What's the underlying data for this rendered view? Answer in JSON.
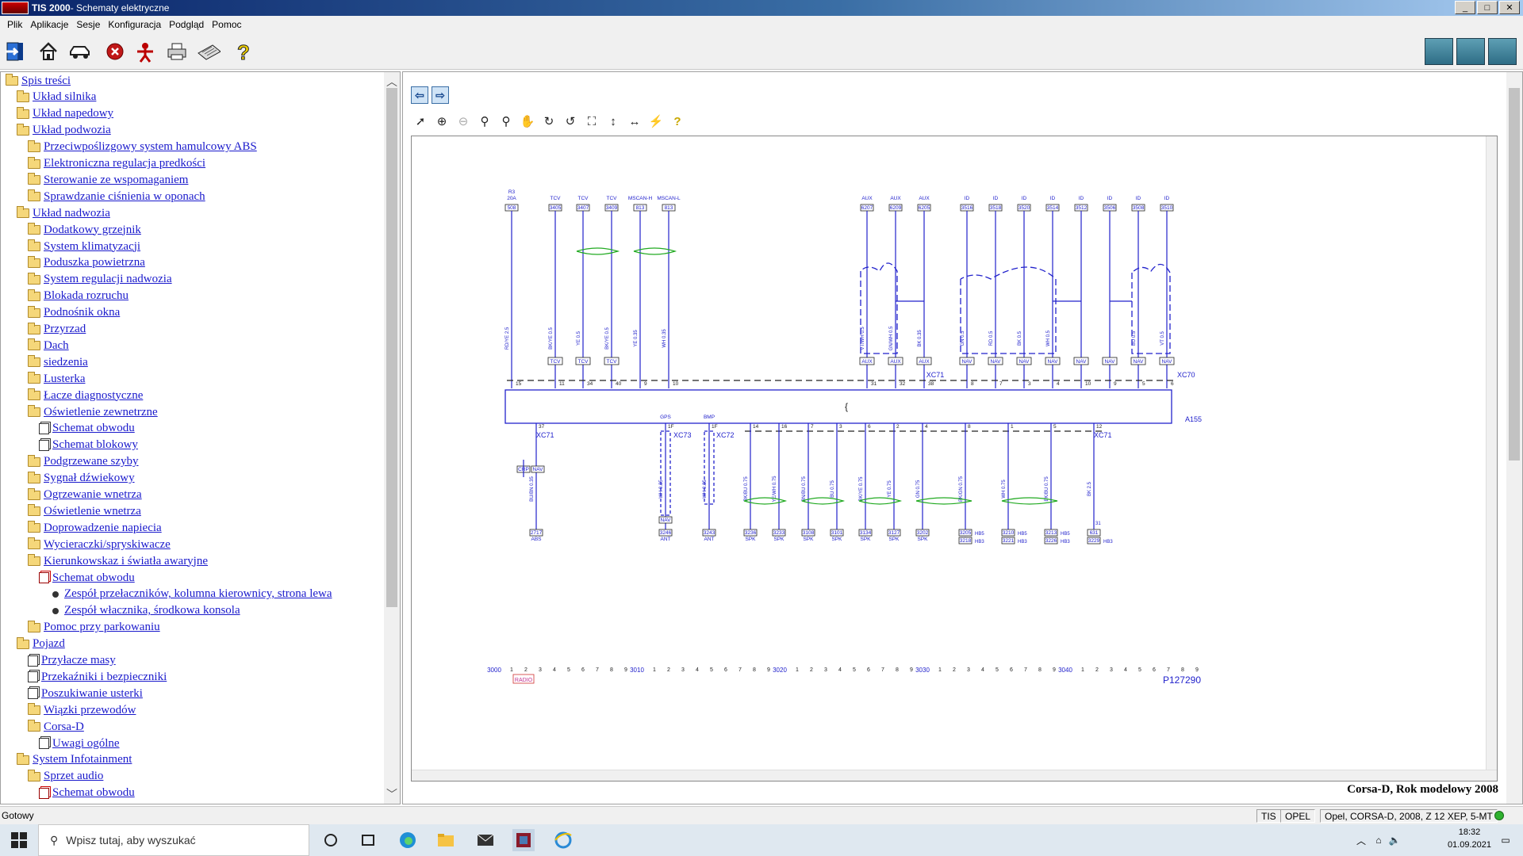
{
  "window": {
    "app": "TIS 2000",
    "title": " - Schematy elektryczne",
    "btn_min": "_",
    "btn_max": "□",
    "btn_close": "✕"
  },
  "menu": [
    "Plik",
    "Aplikacje",
    "Sesje",
    "Konfiguracja",
    "Podgląd",
    "Pomoc"
  ],
  "toolbar_icons": [
    "exit-icon",
    "home-icon",
    "car-icon",
    "stop-icon",
    "person-icon",
    "printer-icon",
    "keyboard-icon",
    "help-icon"
  ],
  "toolbar_right_icons": [
    "vehicle-check-icon",
    "vehicle-diagnostic-icon",
    "vehicle-service-icon"
  ],
  "tree": [
    {
      "label": "Spis treści",
      "level": 0,
      "icon": "folder"
    },
    {
      "label": "Układ silnika",
      "level": 1,
      "icon": "folder"
    },
    {
      "label": "Układ napedowy",
      "level": 1,
      "icon": "folder"
    },
    {
      "label": "Układ podwozia",
      "level": 1,
      "icon": "folder"
    },
    {
      "label": "Przeciwpoślizgowy system hamulcowy ABS",
      "level": 2,
      "icon": "folder"
    },
    {
      "label": "Elektroniczna regulacja predkości",
      "level": 2,
      "icon": "folder"
    },
    {
      "label": "Sterowanie ze wspomaganiem",
      "level": 2,
      "icon": "folder"
    },
    {
      "label": "Sprawdzanie ciśnienia w oponach",
      "level": 2,
      "icon": "folder"
    },
    {
      "label": "Układ nadwozia",
      "level": 1,
      "icon": "folder"
    },
    {
      "label": "Dodatkowy grzejnik",
      "level": 2,
      "icon": "folder"
    },
    {
      "label": "System klimatyzacji",
      "level": 2,
      "icon": "folder"
    },
    {
      "label": "Poduszka powietrzna",
      "level": 2,
      "icon": "folder"
    },
    {
      "label": "System regulacji nadwozia",
      "level": 2,
      "icon": "folder"
    },
    {
      "label": "Blokada rozruchu",
      "level": 2,
      "icon": "folder"
    },
    {
      "label": "Podnośnik okna",
      "level": 2,
      "icon": "folder"
    },
    {
      "label": "Przyrzad",
      "level": 2,
      "icon": "folder"
    },
    {
      "label": "Dach",
      "level": 2,
      "icon": "folder"
    },
    {
      "label": "siedzenia",
      "level": 2,
      "icon": "folder"
    },
    {
      "label": "Lusterka",
      "level": 2,
      "icon": "folder"
    },
    {
      "label": "Łacze diagnostyczne",
      "level": 2,
      "icon": "folder"
    },
    {
      "label": "Oświetlenie zewnetrzne",
      "level": 2,
      "icon": "folder"
    },
    {
      "label": "Schemat obwodu",
      "level": 3,
      "icon": "doc"
    },
    {
      "label": "Schemat blokowy",
      "level": 3,
      "icon": "doc"
    },
    {
      "label": "Podgrzewane szyby",
      "level": 2,
      "icon": "folder"
    },
    {
      "label": "Sygnał dźwiekowy",
      "level": 2,
      "icon": "folder"
    },
    {
      "label": "Ogrzewanie wnetrza",
      "level": 2,
      "icon": "folder"
    },
    {
      "label": "Oświetlenie wnetrza",
      "level": 2,
      "icon": "folder"
    },
    {
      "label": "Doprowadzenie napiecia",
      "level": 2,
      "icon": "folder"
    },
    {
      "label": "Wycieraczki/spryskiwacze",
      "level": 2,
      "icon": "folder"
    },
    {
      "label": "Kierunkowskaz i światła awaryjne",
      "level": 2,
      "icon": "folder"
    },
    {
      "label": "Schemat obwodu",
      "level": 3,
      "icon": "docred"
    },
    {
      "label": "Zespół przełaczników, kolumna kierownicy, strona lewa",
      "level": 4,
      "icon": "bullet"
    },
    {
      "label": "Zespół włacznika, środkowa konsola",
      "level": 4,
      "icon": "bullet"
    },
    {
      "label": "Pomoc przy parkowaniu",
      "level": 2,
      "icon": "folder"
    },
    {
      "label": "Pojazd",
      "level": 1,
      "icon": "folder"
    },
    {
      "label": "Przyłacze masy",
      "level": 2,
      "icon": "doc"
    },
    {
      "label": "Przekaźniki i bezpieczniki",
      "level": 2,
      "icon": "doc"
    },
    {
      "label": "Poszukiwanie usterki",
      "level": 2,
      "icon": "doc"
    },
    {
      "label": "Wiązki przewodów",
      "level": 2,
      "icon": "folder"
    },
    {
      "label": "Corsa-D",
      "level": 2,
      "icon": "folder"
    },
    {
      "label": "Uwagi ogólne",
      "level": 3,
      "icon": "doc"
    },
    {
      "label": "System Infotainment",
      "level": 1,
      "icon": "folder"
    },
    {
      "label": "Sprzet audio",
      "level": 2,
      "icon": "folder"
    },
    {
      "label": "Schemat obwodu",
      "level": 3,
      "icon": "docred"
    }
  ],
  "schematic": {
    "caption": "Corsa-D, Rok modelowy 2008",
    "figure_id": "P127290",
    "module_label": "A155",
    "connector_top_left": "XC71",
    "connector_top_right": "XC70",
    "connector_bottom_left": "XC71",
    "connector_bottom_right": "XC71",
    "connector_gps": "XC73",
    "connector_bmp": "XC72",
    "gps_label": "GPS",
    "bmp_label": "BMP",
    "radio_label": "RADIO",
    "crp_label": "CRP",
    "nav_label": "NAV",
    "top_wires": [
      {
        "head": "R3\n20A",
        "ref": "508",
        "wire": "RD/YE 2.5",
        "pin": "15",
        "tag": ""
      },
      {
        "head": "TCV",
        "ref": "3405",
        "wire": "BK/YE 0.5",
        "pin": "11",
        "tag": "TCV"
      },
      {
        "head": "TCV",
        "ref": "3407",
        "wire": "YE 0.5",
        "pin": "34",
        "tag": "TCV"
      },
      {
        "head": "TCV",
        "ref": "3409",
        "wire": "BK/YE 0.5",
        "pin": "40",
        "tag": "TCV"
      },
      {
        "head": "MSCAN-H",
        "ref": "813",
        "wire": "YE 0.35",
        "pin": "9",
        "tag": ""
      },
      {
        "head": "MSCAN-L",
        "ref": "813",
        "wire": "WH 0.35",
        "pin": "10",
        "tag": ""
      },
      {
        "head": "AUX",
        "ref": "6207",
        "wire": "VT/WH 0.5",
        "pin": "31",
        "tag": "AUX"
      },
      {
        "head": "AUX",
        "ref": "6209",
        "wire": "GN/WH 0.5",
        "pin": "32",
        "tag": "AUX"
      },
      {
        "head": "AUX",
        "ref": "6205",
        "wire": "BK 0.35",
        "pin": "38",
        "tag": "AUX"
      },
      {
        "head": "ID",
        "ref": "3516",
        "wire": "GN 0.5",
        "pin": "8",
        "tag": "NAV"
      },
      {
        "head": "ID",
        "ref": "3518",
        "wire": "RD 0.5",
        "pin": "7",
        "tag": "NAV"
      },
      {
        "head": "ID",
        "ref": "3520",
        "wire": "BK 0.5",
        "pin": "3",
        "tag": "NAV"
      },
      {
        "head": "ID",
        "ref": "3514",
        "wire": "WH 0.5",
        "pin": "4",
        "tag": "NAV"
      },
      {
        "head": "ID",
        "ref": "3512",
        "wire": "",
        "pin": "10",
        "tag": "NAV"
      },
      {
        "head": "ID",
        "ref": "3506",
        "wire": "",
        "pin": "9",
        "tag": "NAV"
      },
      {
        "head": "ID",
        "ref": "3508",
        "wire": "BU 0.5",
        "pin": "5",
        "tag": "NAV"
      },
      {
        "head": "ID",
        "ref": "3510",
        "wire": "VT 0.5",
        "pin": "6",
        "tag": "NAV"
      }
    ],
    "bottom_wires": [
      {
        "pin": "37",
        "wire": "BU/BN 0.35",
        "ref": "2717",
        "dest": "ABS"
      },
      {
        "pin": "1F",
        "wire": "WH 0.35",
        "ref": "3246",
        "dest": "ANT"
      },
      {
        "pin": "1F",
        "wire": "WH 0.35",
        "ref": "3243",
        "dest": "ANT"
      },
      {
        "pin": "14",
        "wire": "BK/BU 0.75",
        "ref": "3236",
        "dest": "SPK"
      },
      {
        "pin": "16",
        "wire": "YE/WH 0.75",
        "ref": "3233",
        "dest": "SPK"
      },
      {
        "pin": "7",
        "wire": "BN/BU 0.75",
        "ref": "3108",
        "dest": "SPK"
      },
      {
        "pin": "3",
        "wire": "BU 0.75",
        "ref": "3101",
        "dest": "SPK"
      },
      {
        "pin": "6",
        "wire": "BK/YE 0.75",
        "ref": "3134",
        "dest": "SPK"
      },
      {
        "pin": "2",
        "wire": "YE 0.75",
        "ref": "3127",
        "dest": "SPK"
      },
      {
        "pin": "4",
        "wire": "GN 0.75",
        "ref": "3202",
        "dest": "SPK"
      },
      {
        "pin": "8",
        "wire": "BK/GN 0.75",
        "ref": "3205",
        "dest": "SPK"
      },
      {
        "pin": "1",
        "wire": "WH 0.75",
        "ref": "3210",
        "dest": "SPK"
      },
      {
        "pin": "5",
        "wire": "BK/BU 0.75",
        "ref": "3213",
        "dest": "SPK"
      },
      {
        "pin": "12",
        "wire": "BK 2.5",
        "ref": "631",
        "dest": ""
      }
    ],
    "bottom_extra_refs": [
      {
        "ref": "3218",
        "tag": "HB3"
      },
      {
        "ref": "3221",
        "tag": "HB3"
      },
      {
        "ref": "3226",
        "tag": "HB3"
      },
      {
        "ref": "3229",
        "tag": "HB3"
      }
    ],
    "hb5_label": "HB5",
    "ground_pin": "31",
    "ruler_majors": [
      "3000",
      "3010",
      "3020",
      "3030",
      "3040"
    ],
    "ruler_minors": [
      "1",
      "2",
      "3",
      "4",
      "5",
      "6",
      "7",
      "8",
      "9"
    ]
  },
  "status": {
    "left": "Gotowy",
    "tis": "TIS",
    "brand": "OPEL",
    "vehicle": "Opel, CORSA-D, 2008, Z 12 XEP, 5-MT"
  },
  "taskbar": {
    "search_placeholder": "Wpisz tutaj, aby wyszukać",
    "time": "18:32",
    "date": "01.09.2021"
  },
  "colors": {
    "schematic": "#2222cc",
    "harness_dash": "#222222",
    "twist": "#22aa22"
  }
}
